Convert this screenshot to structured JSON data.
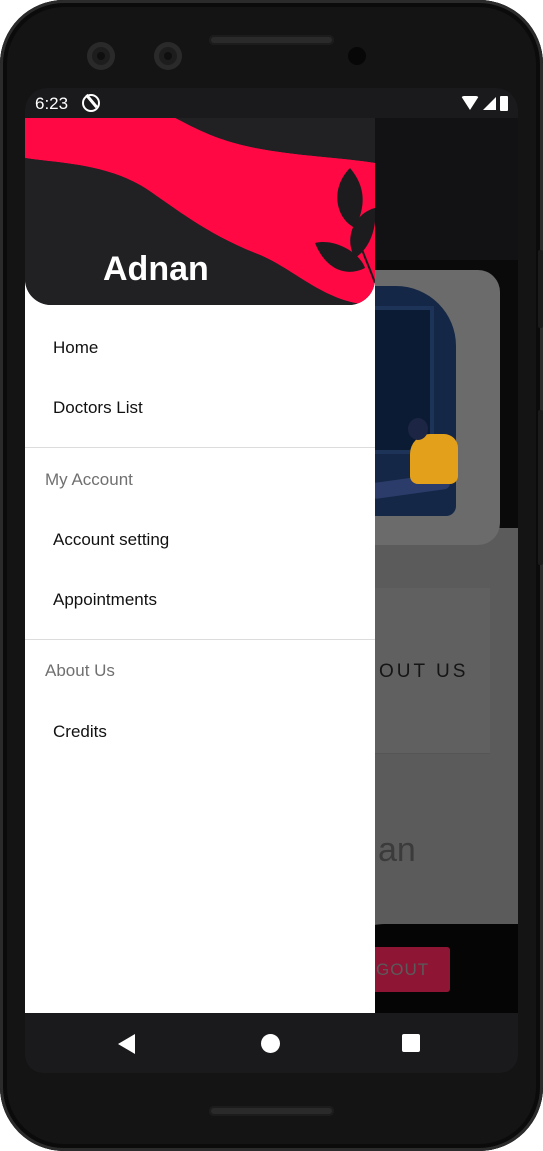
{
  "status_bar": {
    "time": "6:23",
    "icons": [
      "data-saver-icon",
      "wifi-icon",
      "signal-icon",
      "battery-icon"
    ]
  },
  "drawer": {
    "user_name": "Adnan",
    "items": [
      {
        "label": "Home"
      },
      {
        "label": "Doctors List"
      }
    ],
    "sections": [
      {
        "title": "My Account",
        "items": [
          {
            "label": "Account setting"
          },
          {
            "label": "Appointments"
          }
        ]
      },
      {
        "title": "About Us",
        "items": [
          {
            "label": "Credits"
          }
        ]
      }
    ]
  },
  "background_screen": {
    "about_button_label": "OUT US",
    "name_partial": "an",
    "logout_partial": "GOUT"
  },
  "colors": {
    "accent": "#ff0844",
    "header_dark": "#212124",
    "leaf_dark": "#1c1c1e"
  },
  "nav_bar": {
    "icons": [
      "back-icon",
      "home-icon",
      "recents-icon"
    ]
  }
}
